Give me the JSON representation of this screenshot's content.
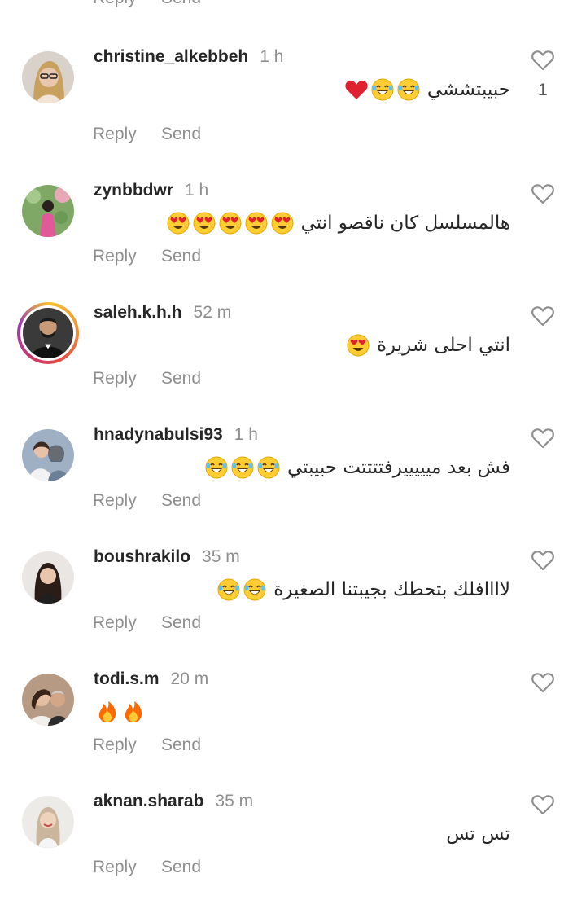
{
  "top_actions": {
    "reply": "Reply",
    "send": "Send"
  },
  "comments": [
    {
      "username": "christine_alkebbeh",
      "time": "1 h",
      "text": "حبيبتششي",
      "emojis": [
        "heart",
        "laugh",
        "laugh"
      ],
      "likes": "1",
      "reply": "Reply",
      "send": "Send"
    },
    {
      "username": "zynbbdwr",
      "time": "1 h",
      "text": "هالمسلسل كان ناقصو انتي",
      "emojis": [
        "heart-eyes",
        "heart-eyes",
        "heart-eyes",
        "heart-eyes",
        "heart-eyes"
      ],
      "likes": "",
      "reply": "Reply",
      "send": "Send"
    },
    {
      "username": "saleh.k.h.h",
      "time": "52 m",
      "text": "انتي احلى شريرة",
      "emojis": [
        "heart-eyes"
      ],
      "likes": "",
      "reply": "Reply",
      "send": "Send"
    },
    {
      "username": "hnadynabulsi93",
      "time": "1 h",
      "text": "فش بعد ميييييرفتتتتت حبيبتي",
      "emojis": [
        "laugh",
        "laugh",
        "laugh"
      ],
      "likes": "",
      "reply": "Reply",
      "send": "Send"
    },
    {
      "username": "boushrakilo",
      "time": "35 m",
      "text": "لاااافلك بتحطك بجيبتنا الصغيرة",
      "emojis": [
        "laugh",
        "laugh"
      ],
      "likes": "",
      "reply": "Reply",
      "send": "Send"
    },
    {
      "username": "todi.s.m",
      "time": "20 m",
      "text": "",
      "emojis": [
        "fire",
        "fire"
      ],
      "likes": "",
      "reply": "Reply",
      "send": "Send"
    },
    {
      "username": "aknan.sharab",
      "time": "35 m",
      "text": "تس تس",
      "emojis": [],
      "likes": "",
      "reply": "Reply",
      "send": "Send"
    }
  ],
  "colors": {
    "text": "#262626",
    "secondary": "#8e8e8e",
    "heart": "#e0202e",
    "emoji_face": "#ffcc33"
  }
}
